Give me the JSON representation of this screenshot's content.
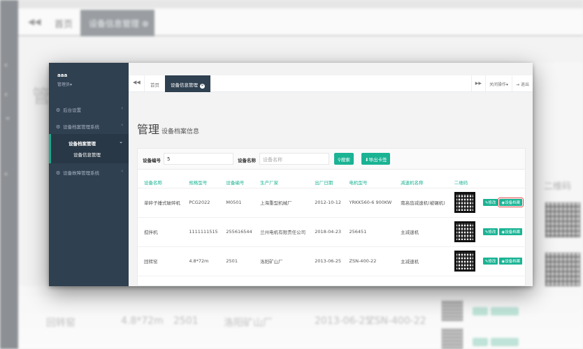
{
  "user": {
    "name": "aaa",
    "role": "管理员▾"
  },
  "sidebar": {
    "items": [
      {
        "label": "后台设置",
        "icon": "gears-icon"
      },
      {
        "label": "设备档案管理系统",
        "icon": "gears-icon"
      },
      {
        "label": "设备档案管理",
        "active": true
      },
      {
        "label": "设备信息管理",
        "sub": true
      },
      {
        "label": "设备故障管理系统",
        "icon": "gears-icon"
      }
    ]
  },
  "tabs": {
    "back": "◀◀",
    "home": "首页",
    "active": "设备信息管理",
    "forward": "▶▶",
    "close_ops": "关闭操作▾",
    "logout": "退出"
  },
  "page": {
    "title": "管理",
    "subtitle": "设备档案信息"
  },
  "search": {
    "no_label": "设备编号",
    "no_value": "5",
    "name_label": "设备名称",
    "name_placeholder": "设备名称",
    "search_button": "搜索",
    "export_button": "导出卡签"
  },
  "table": {
    "columns": [
      "设备名称",
      "规格型号",
      "设备编号",
      "生产厂家",
      "出厂日期",
      "电机型号",
      "减速机名称",
      "二维码",
      ""
    ],
    "rows": [
      {
        "name": "单碎子捶式破碎机",
        "spec": "PCG2022",
        "no": "M0501",
        "maker": "上海重型机械厂",
        "date": "2012-10-12",
        "motor": "YRKK560-6 900KW",
        "reducer": "南高齿减速机(被碾机)",
        "edit": "修改",
        "archive": "设备档案"
      },
      {
        "name": "搅拌机",
        "spec": "1111111515",
        "no": "255616544",
        "maker": "兰州电机有限责任公司",
        "date": "2018-04-23",
        "motor": "256451",
        "reducer": "主减速机",
        "edit": "修改",
        "archive": "设备档案"
      },
      {
        "name": "回转窑",
        "spec": "4.8*72m",
        "no": "2501",
        "maker": "洛阳矿山厂",
        "date": "2013-06-25",
        "motor": "ZSN-400-22",
        "reducer": "主减速机",
        "edit": "修改",
        "archive": "设备档案"
      }
    ]
  },
  "background": {
    "back": "◀◀",
    "home": "首页",
    "active": "设备信息管理",
    "title": "管",
    "qr_title": "二维码",
    "row": {
      "name": "回转窑",
      "spec": "4.8*72m",
      "no": "2501",
      "maker": "洛阳矿山厂",
      "date": "2013-06-25",
      "motor": "ZSN-400-22"
    }
  },
  "colors": {
    "sidebar": "#2f4050",
    "accent": "#1ab394",
    "highlight": "#e24c4c"
  }
}
